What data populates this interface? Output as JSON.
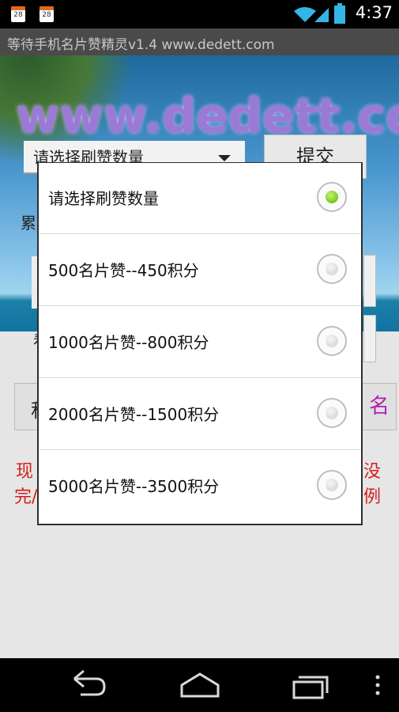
{
  "status_bar": {
    "time": "4:37",
    "notifications": [
      {
        "icon": "calendar-icon",
        "day": "28"
      },
      {
        "icon": "calendar-icon",
        "day": "28"
      }
    ],
    "system_icons": [
      "wifi-icon",
      "signal-icon",
      "battery-icon"
    ]
  },
  "app": {
    "title": "等待手机名片赞精灵v1.4 www.dedett.com",
    "watermark": "www.dedett.com"
  },
  "background_ui": {
    "spinner_value": "请选择刷赞数量",
    "submit_label": "提交",
    "fragment_1": "累",
    "fragment_2": "看",
    "fragment_3": "积",
    "fragment_right": "名",
    "red_left_1": "现",
    "red_left_2": "完/",
    "red_right_1": "没",
    "red_right_2": "例"
  },
  "dialog": {
    "options": [
      {
        "label": "请选择刷赞数量",
        "selected": true
      },
      {
        "label": "500名片赞--450积分",
        "selected": false
      },
      {
        "label": "1000名片赞--800积分",
        "selected": false
      },
      {
        "label": "2000名片赞--1500积分",
        "selected": false
      },
      {
        "label": "5000名片赞--3500积分",
        "selected": false
      }
    ]
  },
  "nav_bar": {
    "buttons": [
      "back-icon",
      "home-icon",
      "recent-apps-icon",
      "menu-icon"
    ]
  },
  "colors": {
    "radio_selected": "#7ccc1e",
    "red_text": "#d61e1e",
    "purple_text": "#b21fb2",
    "title_bar": "#4a4a4a"
  }
}
